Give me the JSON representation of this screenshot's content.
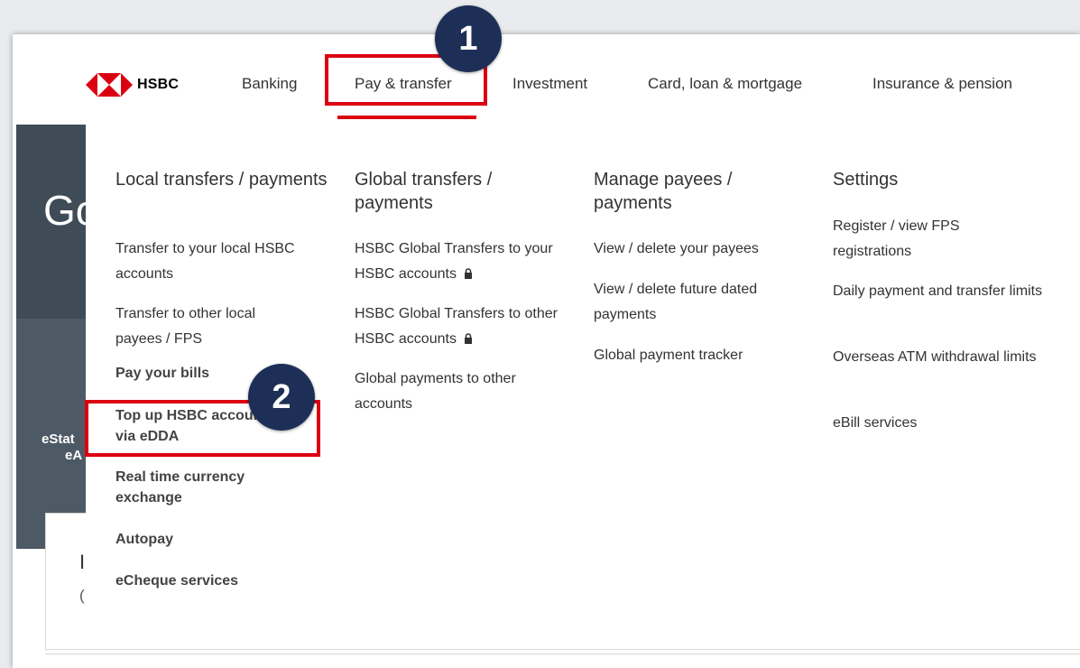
{
  "brand": {
    "name": "HSBC"
  },
  "nav": {
    "items": [
      "Banking",
      "Pay & transfer",
      "Investment",
      "Card, loan & mortgage",
      "Insurance & pension"
    ]
  },
  "background": {
    "hero_title_fragment": "Go",
    "side_line1": "eStat",
    "side_line2": "eA",
    "content_fragment1": "I",
    "content_fragment2": "("
  },
  "menu": {
    "local": {
      "heading": "Local transfers / payments",
      "links": [
        "Transfer to your local HSBC accounts",
        "Transfer to other local payees / FPS",
        "Pay your bills",
        "Top up HSBC accounts via eDDA",
        "Real time currency exchange",
        "Autopay",
        "eCheque services"
      ]
    },
    "global": {
      "heading": "Global transfers / payments",
      "links": [
        "HSBC Global Transfers to your HSBC accounts",
        "HSBC Global Transfers to other HSBC accounts",
        "Global payments to other accounts"
      ]
    },
    "payees": {
      "heading": "Manage payees / payments",
      "links": [
        "View / delete your payees",
        "View / delete future dated payments",
        "Global payment tracker"
      ]
    },
    "settings": {
      "heading": "Settings",
      "links": [
        "Register / view FPS registrations",
        "Daily payment and transfer limits",
        "Overseas ATM withdrawal limits",
        "eBill services"
      ]
    }
  },
  "annotations": {
    "step1": "1",
    "step2": "2",
    "highlight_color": "#db0011",
    "badge_color": "#1e2f57"
  },
  "icons": {
    "lock": "lock-icon",
    "logo": "hsbc-hexagon-logo"
  }
}
